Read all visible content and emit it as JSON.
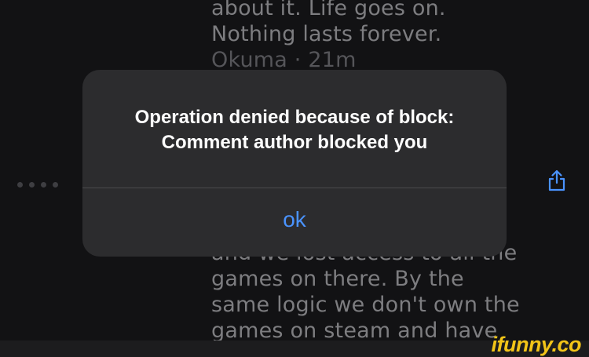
{
  "background_post": {
    "top_lines": [
      "about it. Life goes on.",
      "Nothing lasts forever.",
      "Okuma · 21m"
    ],
    "bottom_lines": [
      "and we lost access to all the",
      "games on there. By the",
      "same logic we don't own the",
      "games on steam and have"
    ]
  },
  "alert": {
    "message_line1": "Operation denied because of block:",
    "message_line2": "Comment author blocked you",
    "ok_label": "ok"
  },
  "icons": {
    "more": "more-dots-icon",
    "share": "share-icon"
  },
  "watermark": "ifunny.co",
  "colors": {
    "accent": "#4a93ff",
    "alert_bg": "#2c2c2e",
    "page_bg": "#121214",
    "watermark": "#f2c418"
  }
}
